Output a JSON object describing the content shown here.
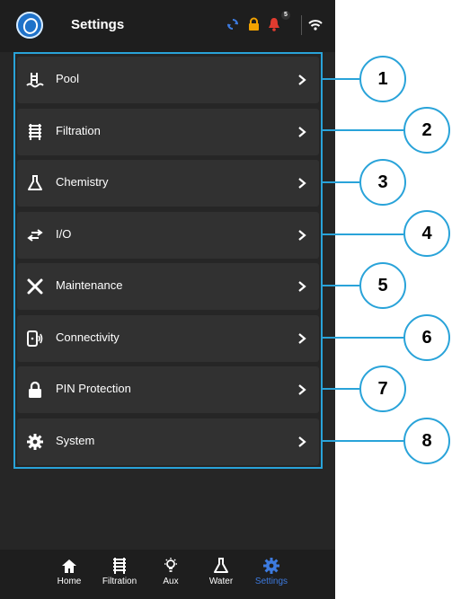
{
  "header": {
    "title": "Settings",
    "notification_count": "5",
    "icons": [
      "app-logo-icon",
      "sync-icon",
      "lock-icon",
      "bell-icon",
      "wifi-icon"
    ],
    "colors": {
      "sync": "#3d7be0",
      "lock": "#f2a200",
      "bell": "#e03b2f"
    }
  },
  "menu": [
    {
      "label": "Pool",
      "icon": "pool-icon",
      "callout": "1"
    },
    {
      "label": "Filtration",
      "icon": "filtration-icon",
      "callout": "2"
    },
    {
      "label": "Chemistry",
      "icon": "flask-icon",
      "callout": "3"
    },
    {
      "label": "I/O",
      "icon": "io-arrows-icon",
      "callout": "4"
    },
    {
      "label": "Maintenance",
      "icon": "tools-icon",
      "callout": "5"
    },
    {
      "label": "Connectivity",
      "icon": "connectivity-icon",
      "callout": "6"
    },
    {
      "label": "PIN Protection",
      "icon": "lock-icon",
      "callout": "7"
    },
    {
      "label": "System",
      "icon": "gear-icon",
      "callout": "8"
    }
  ],
  "bottom_nav": [
    {
      "label": "Home",
      "icon": "home-icon"
    },
    {
      "label": "Filtration",
      "icon": "filtration-icon"
    },
    {
      "label": "Aux",
      "icon": "bulb-icon"
    },
    {
      "label": "Water",
      "icon": "flask-icon"
    },
    {
      "label": "Settings",
      "icon": "gear-icon",
      "active": true
    }
  ],
  "accent_color": "#29a3d9"
}
